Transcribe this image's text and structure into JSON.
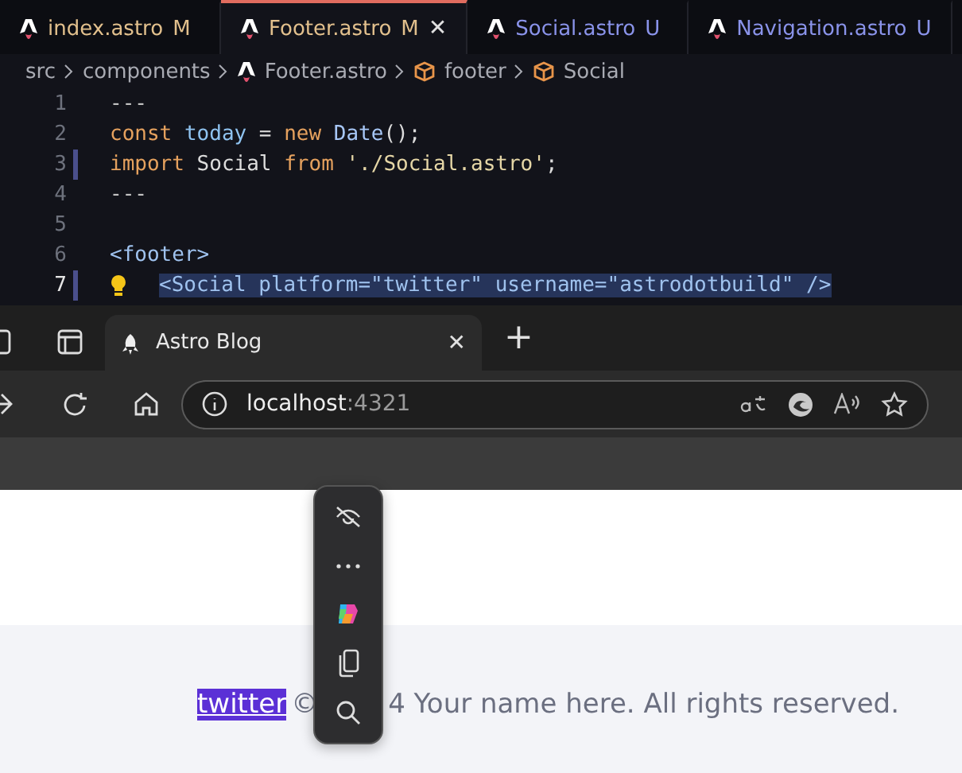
{
  "editor": {
    "tabs": [
      {
        "label": "index.astro",
        "badge": "M",
        "color": "#e2c08d",
        "selected": false
      },
      {
        "label": "Footer.astro",
        "badge": "M",
        "color": "#e2c08d",
        "selected": true,
        "close": "✕"
      },
      {
        "label": "Social.astro",
        "badge": "U",
        "color": "#8a93ea",
        "selected": false
      },
      {
        "label": "Navigation.astro",
        "badge": "U",
        "color": "#8a93ea",
        "selected": false
      }
    ],
    "breadcrumb": [
      {
        "label": "src",
        "kind": "folder"
      },
      {
        "label": "components",
        "kind": "folder"
      },
      {
        "label": "Footer.astro",
        "kind": "file"
      },
      {
        "label": "footer",
        "kind": "element"
      },
      {
        "label": "Social",
        "kind": "element"
      }
    ],
    "lines": [
      {
        "number": "1",
        "modified": false,
        "selected": false,
        "tokens": [
          {
            "text": "---",
            "kind": "punct"
          }
        ]
      },
      {
        "number": "2",
        "modified": false,
        "selected": false,
        "tokens": [
          {
            "text": "const",
            "kind": "keyword"
          },
          {
            "text": " today",
            "kind": "variable"
          },
          {
            "text": " = ",
            "kind": "plain"
          },
          {
            "text": "new",
            "kind": "keyword"
          },
          {
            "text": " Date",
            "kind": "class"
          },
          {
            "text": "();",
            "kind": "plain"
          }
        ]
      },
      {
        "number": "3",
        "modified": true,
        "selected": false,
        "tokens": [
          {
            "text": "import",
            "kind": "keyword"
          },
          {
            "text": " Social ",
            "kind": "plain"
          },
          {
            "text": "from",
            "kind": "keyword"
          },
          {
            "text": " './Social.astro'",
            "kind": "string"
          },
          {
            "text": ";",
            "kind": "plain"
          }
        ]
      },
      {
        "number": "4",
        "modified": false,
        "selected": false,
        "tokens": [
          {
            "text": "---",
            "kind": "punct"
          }
        ]
      },
      {
        "number": "5",
        "modified": false,
        "selected": false
      },
      {
        "number": "6",
        "modified": false,
        "selected": false,
        "tokens": [
          {
            "text": "<footer>",
            "kind": "tag"
          }
        ]
      },
      {
        "number": "7",
        "modified": true,
        "selected": true,
        "lightbulb": true,
        "indent": true,
        "tokens": [
          {
            "text": "<Social platform=\"twitter\" username=\"astrodotbuild\" />",
            "kind": "tag"
          }
        ]
      }
    ]
  },
  "browser": {
    "tab": {
      "title": "Astro Blog",
      "close": "✕"
    },
    "new_tab": "+",
    "address": {
      "host": "localhost",
      "port": ":4321"
    }
  },
  "page": {
    "link": "twitter",
    "link_selected": true,
    "copyright": "©",
    "text": "4 Your name here. All rights reserved."
  },
  "selection_toolbar": {
    "buttons": [
      {
        "kind": "hide"
      },
      {
        "kind": "more"
      },
      {
        "kind": "copilot"
      },
      {
        "kind": "copy"
      },
      {
        "kind": "search"
      }
    ]
  }
}
